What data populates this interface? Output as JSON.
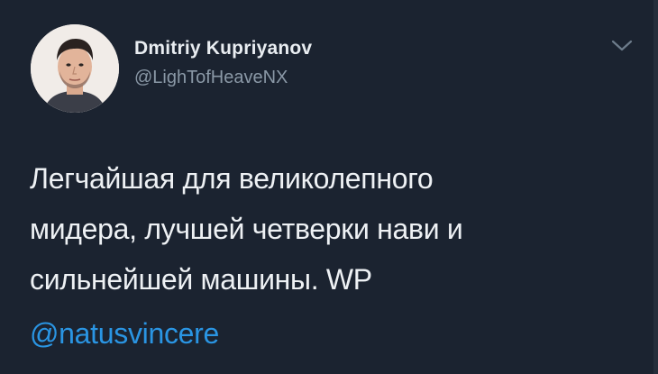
{
  "author": {
    "display_name": "Dmitriy Kupriyanov",
    "handle": "@LighTofHeaveNX"
  },
  "tweet": {
    "lines": [
      "Легчайшая для великолепного",
      "мидера, лучшей четверки нави и",
      "сильнейшей машины. WP"
    ],
    "mention": "@natusvincere"
  },
  "icons": {
    "menu": "chevron-down-icon",
    "avatar": "profile-photo"
  },
  "colors": {
    "background": "#1b2330",
    "text": "#eef1f4",
    "handle": "#8a98a6",
    "link": "#2a95e3"
  }
}
